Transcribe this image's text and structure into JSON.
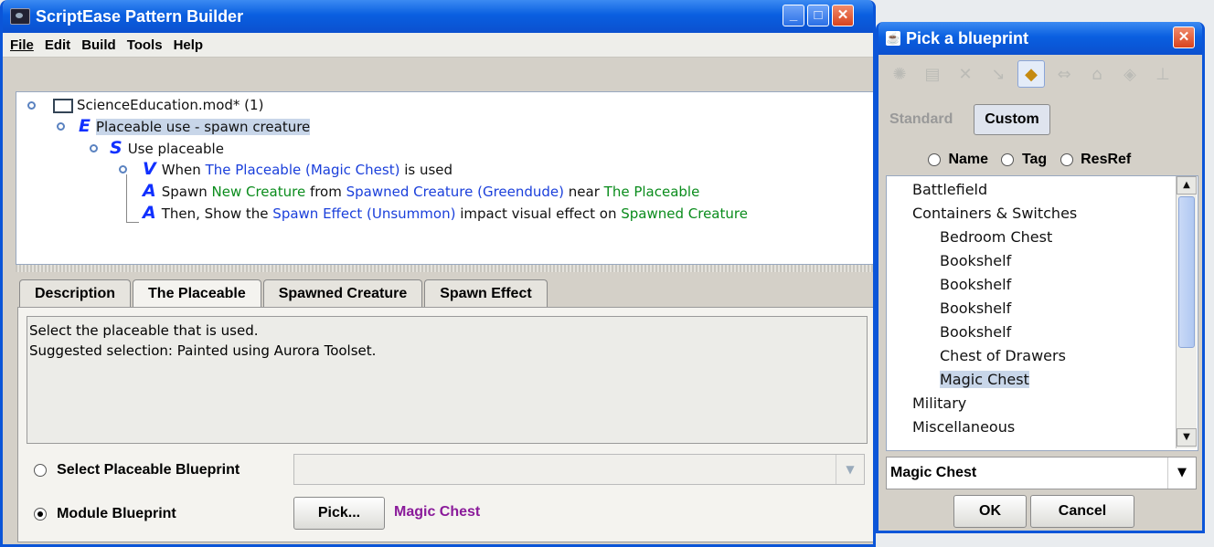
{
  "main_window": {
    "title": "ScriptEase Pattern Builder",
    "menu": [
      "File",
      "Edit",
      "Build",
      "Tools",
      "Help"
    ],
    "tree": {
      "root": "ScienceEducation.mod* (1)",
      "encounter_letter": "E",
      "encounter": "Placeable use - spawn creature",
      "script_letter": "S",
      "script": "Use placeable",
      "cause_letter": "V",
      "cause": {
        "pre": "When ",
        "subject": "The Placeable (Magic Chest)",
        "post": " is used"
      },
      "action1_letter": "A",
      "action1": {
        "pre": "Spawn ",
        "new": "New Creature",
        "mid": " from ",
        "spawned": "Spawned Creature (Greendude)",
        "mid2": " near ",
        "place": "The Placeable"
      },
      "action2_letter": "A",
      "action2": {
        "pre": "Then, Show the ",
        "effect": "Spawn Effect (Unsummon)",
        "mid": " impact visual effect on ",
        "target": "Spawned Creature"
      }
    },
    "tabs": [
      "Description",
      "The Placeable",
      "Spawned Creature",
      "Spawn Effect"
    ],
    "active_tab": "The Placeable",
    "description_lines": [
      "Select the placeable that is used.",
      "Suggested selection: Painted using Aurora Toolset."
    ],
    "option_select": "Select Placeable Blueprint",
    "option_module": "Module Blueprint",
    "pick_button": "Pick...",
    "picked_value": "Magic Chest",
    "picked_color": "#8a1a9a"
  },
  "picker": {
    "title": "Pick a blueprint",
    "mode_tabs": [
      "Standard",
      "Custom"
    ],
    "active_mode": "Custom",
    "search_options": [
      "Name",
      "Tag",
      "ResRef"
    ],
    "tree_items": [
      {
        "label": "Battlefield",
        "level": 0
      },
      {
        "label": "Containers & Switches",
        "level": 0
      },
      {
        "label": "Bedroom Chest",
        "level": 1
      },
      {
        "label": "Bookshelf",
        "level": 1
      },
      {
        "label": "Bookshelf",
        "level": 1
      },
      {
        "label": "Bookshelf",
        "level": 1
      },
      {
        "label": "Bookshelf",
        "level": 1
      },
      {
        "label": "Chest of Drawers",
        "level": 1
      },
      {
        "label": "Magic Chest",
        "level": 1,
        "selected": true
      },
      {
        "label": "Military",
        "level": 0
      },
      {
        "label": "Miscellaneous",
        "level": 0
      }
    ],
    "selected_value": "Magic Chest",
    "ok_button": "OK",
    "cancel_button": "Cancel"
  }
}
